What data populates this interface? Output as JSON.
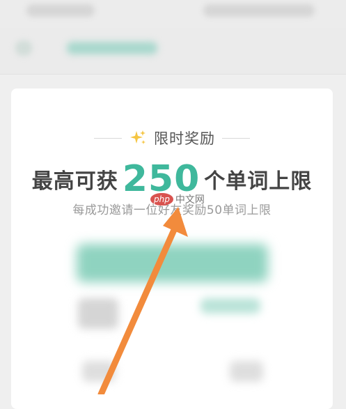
{
  "promo": {
    "tag": "限时奖励",
    "headline_prefix": "最高可获",
    "headline_number": "250",
    "headline_suffix": "个单词上限",
    "subline": "每成功邀请一位好友奖励50单词上限"
  },
  "watermark": {
    "badge": "php",
    "text": "中文网"
  },
  "colors": {
    "accent": "#3fb89c",
    "arrow": "#f28b3c",
    "sparkle": "#f5c542"
  },
  "icons": {
    "tag_icon": "sparkle-icon",
    "annotation": "arrow-icon"
  }
}
